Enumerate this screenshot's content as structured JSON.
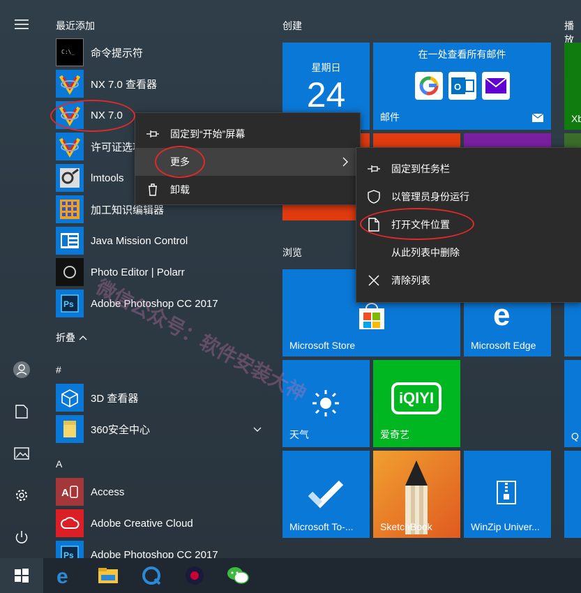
{
  "recent_header": "最近添加",
  "recent_apps": [
    {
      "label": "命令提示符",
      "icon": "cmd-icon"
    },
    {
      "label": "NX 7.0 查看器",
      "icon": "nx-icon"
    },
    {
      "label": "NX 7.0",
      "icon": "nx-icon"
    },
    {
      "label": "许可证选项",
      "icon": "nx-icon"
    },
    {
      "label": "lmtools",
      "icon": "lmtools-icon"
    },
    {
      "label": "加工知识编辑器",
      "icon": "grid-icon"
    },
    {
      "label": "Java Mission Control",
      "icon": "java-mc-icon"
    },
    {
      "label": "Photo Editor | Polarr",
      "icon": "polarr-icon"
    },
    {
      "label": "Adobe Photoshop CC 2017",
      "icon": "photoshop-icon"
    }
  ],
  "collapse_label": "折叠",
  "hash_header": "#",
  "hash_apps": [
    {
      "label": "3D 查看器",
      "icon": "cube-icon"
    },
    {
      "label": "360安全中心",
      "icon": "folder-icon"
    }
  ],
  "a_header": "A",
  "a_apps": [
    {
      "label": "Access",
      "icon": "access-icon"
    },
    {
      "label": "Adobe Creative Cloud",
      "icon": "creative-cloud-icon"
    },
    {
      "label": "Adobe Photoshop CC 2017",
      "icon": "photoshop-icon"
    }
  ],
  "groups": {
    "create": "创建",
    "play": "播放",
    "browse": "浏览"
  },
  "tiles": {
    "calendar_day": "星期日",
    "calendar_date": "24",
    "mail_caption": "在一处查看所有邮件",
    "mail_label": "邮件",
    "xbox_label": "Xb",
    "store_label": "Microsoft Store",
    "edge_label": "Microsoft Edge",
    "weather_label": "天气",
    "iqiyi_label": "爱奇艺",
    "iqiyi_logo": "iQIYI",
    "todo_label": "Microsoft To-...",
    "sketchbook_label": "SketchBook",
    "winzip_label": "WinZip Univer...",
    "partial_label": "Q"
  },
  "context_menu": [
    {
      "label": "固定到“开始”屏幕",
      "icon": "pin-icon"
    },
    {
      "label": "更多",
      "icon": ""
    },
    {
      "label": "卸载",
      "icon": "trash-icon"
    }
  ],
  "submenu": [
    {
      "label": "固定到任务栏",
      "icon": "pin-icon"
    },
    {
      "label": "以管理员身份运行",
      "icon": "shield-icon"
    },
    {
      "label": "打开文件位置",
      "icon": "file-icon"
    },
    {
      "label": "从此列表中删除",
      "icon": ""
    },
    {
      "label": "清除列表",
      "icon": "x-icon"
    }
  ],
  "watermark": "微信公众号：软件安装大神",
  "colors": {
    "tile_blue": "#0a78d7",
    "tile_green": "#00b722",
    "menu_bg": "#2b2b2b",
    "highlight": "#e0292a"
  }
}
